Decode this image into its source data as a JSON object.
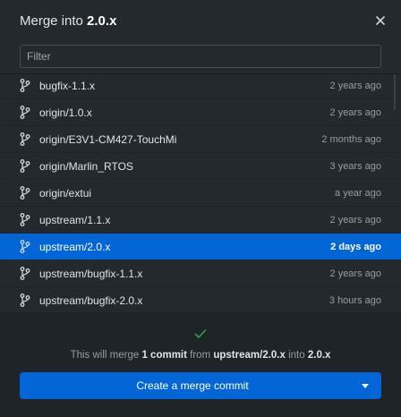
{
  "header": {
    "title_prefix": "Merge into",
    "target_branch": "2.0.x",
    "close_icon": "close-icon"
  },
  "filter": {
    "placeholder": "Filter",
    "value": ""
  },
  "branches": [
    {
      "name": "bugfix-1.1.x",
      "time": "2 years ago",
      "selected": false
    },
    {
      "name": "origin/1.0.x",
      "time": "2 years ago",
      "selected": false
    },
    {
      "name": "origin/E3V1-CM427-TouchMi",
      "time": "2 months ago",
      "selected": false
    },
    {
      "name": "origin/Marlin_RTOS",
      "time": "3 years ago",
      "selected": false
    },
    {
      "name": "origin/extui",
      "time": "a year ago",
      "selected": false
    },
    {
      "name": "upstream/1.1.x",
      "time": "2 years ago",
      "selected": false
    },
    {
      "name": "upstream/2.0.x",
      "time": "2 days ago",
      "selected": true
    },
    {
      "name": "upstream/bugfix-1.1.x",
      "time": "2 years ago",
      "selected": false
    },
    {
      "name": "upstream/bugfix-2.0.x",
      "time": "3 hours ago",
      "selected": false
    }
  ],
  "footer": {
    "status_icon": "check-icon",
    "summary_prefix": "This will merge",
    "commit_count": "1 commit",
    "summary_from": "from",
    "source_branch": "upstream/2.0.x",
    "summary_into": "into",
    "target_branch": "2.0.x",
    "button_label": "Create a merge commit",
    "dropdown_icon": "caret-down-icon"
  },
  "colors": {
    "background": "#24292e",
    "footer_background": "#1f2428",
    "accent": "#0366d6",
    "success": "#28a745"
  }
}
